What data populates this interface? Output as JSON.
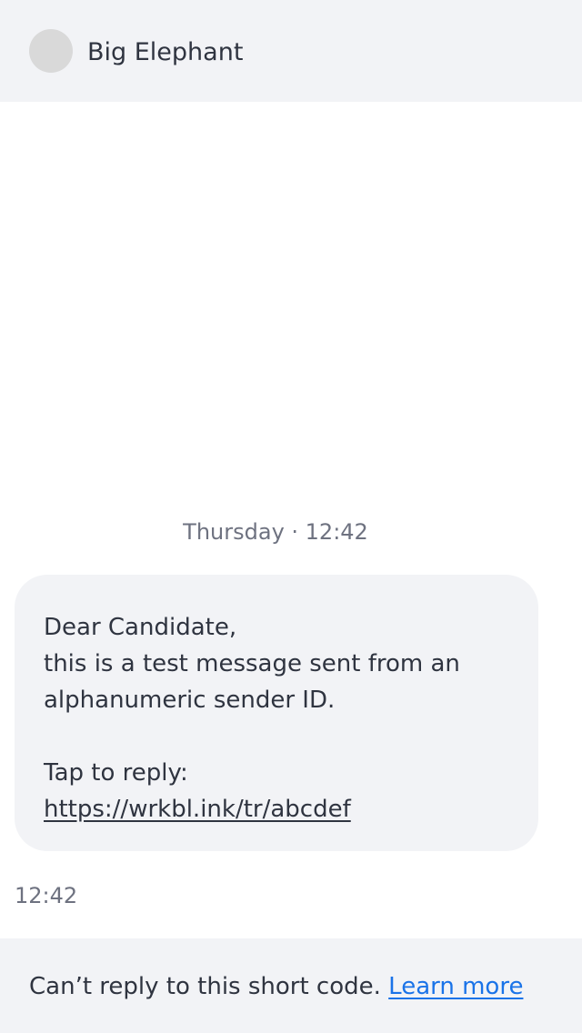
{
  "header": {
    "contact_name": "Big Elephant"
  },
  "conversation": {
    "day_stamp": "Thursday · 12:42",
    "message": {
      "lines": [
        "Dear Candidate,",
        "this is a test message sent from an",
        "alphanumeric sender ID.",
        "Tap to reply:"
      ],
      "link": "https://wrkbl.ink/tr/abcdef",
      "time": "12:42"
    }
  },
  "footer": {
    "notice": "Can’t reply to this short code.",
    "learn_more": "Learn more"
  },
  "colors": {
    "header_bg": "#f2f3f6",
    "bubble_bg": "#f2f3f6",
    "link_blue": "#1a73e8",
    "text": "#2f3440",
    "muted_text": "#6e7280",
    "avatar": "#d9d9d9"
  }
}
